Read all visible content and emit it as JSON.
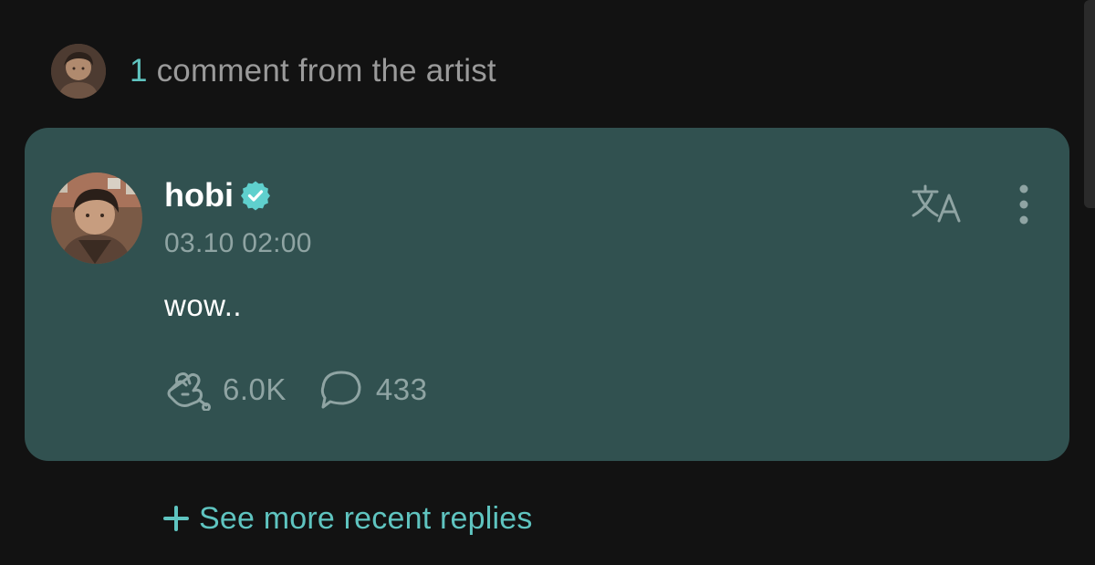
{
  "header": {
    "comment_count": "1",
    "comment_label": "comment from the artist",
    "avatar_icon": "artist-avatar"
  },
  "comment": {
    "author": "hobi",
    "verified": true,
    "timestamp": "03.10 02:00",
    "body": "wow..",
    "likes": "6.0K",
    "replies": "433",
    "translate_icon": "translate-icon",
    "more_icon": "more-vertical-icon"
  },
  "footer": {
    "see_more_label": "See more recent replies"
  },
  "colors": {
    "background": "#121212",
    "card": "#315150",
    "accent": "#5fc4c0",
    "muted": "#8fa4a3"
  }
}
